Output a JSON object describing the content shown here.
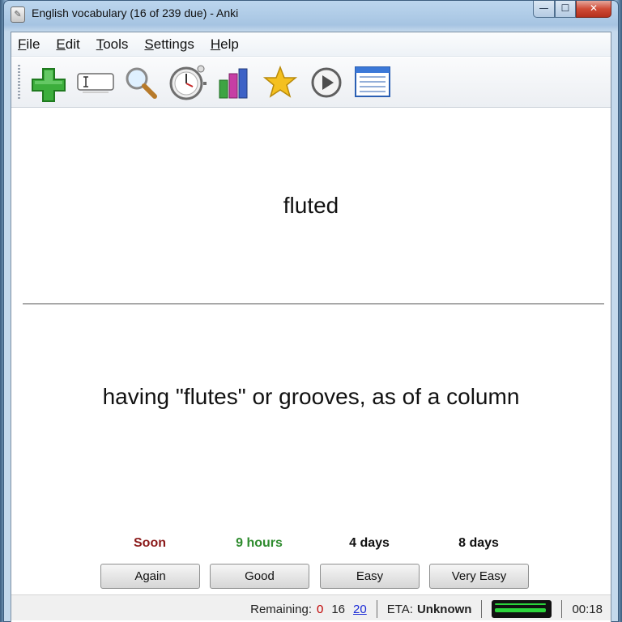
{
  "window": {
    "title": "English vocabulary (16 of 239 due) - Anki",
    "controls": {
      "minimize": "—",
      "maximize": "☐",
      "close": "✕"
    }
  },
  "menu": [
    "File",
    "Edit",
    "Tools",
    "Settings",
    "Help"
  ],
  "toolbar": {
    "icons": [
      "add-card-icon",
      "edit-card-icon",
      "search-icon",
      "timer-icon",
      "stats-icon",
      "star-icon",
      "play-icon",
      "card-list-icon"
    ]
  },
  "card": {
    "question": "fluted",
    "answer": "having \"flutes\" or grooves, as of a column"
  },
  "answers": [
    {
      "interval": "Soon",
      "label": "Again",
      "color": "#8b1a1a"
    },
    {
      "interval": "9 hours",
      "label": "Good",
      "color": "#2e8b2e"
    },
    {
      "interval": "4 days",
      "label": "Easy",
      "color": "#111111"
    },
    {
      "interval": "8 days",
      "label": "Very Easy",
      "color": "#111111"
    }
  ],
  "status": {
    "remaining_label": "Remaining:",
    "remaining_new": "0",
    "remaining_review": "16",
    "remaining_learning": "20",
    "eta_label": "ETA:",
    "eta_value": "Unknown",
    "progress": 0.95,
    "timer": "00:18"
  }
}
